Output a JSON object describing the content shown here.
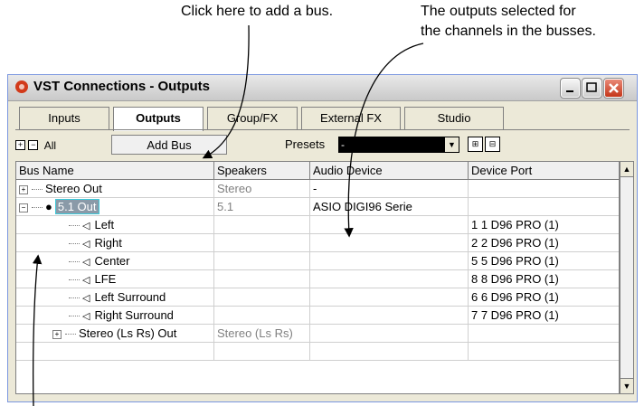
{
  "callouts": {
    "add_bus": "Click here to add a bus.",
    "outputs_line1": "The outputs selected for",
    "outputs_line2": "the channels in the busses."
  },
  "window": {
    "title": "VST Connections - Outputs",
    "controls": [
      "minimize",
      "maximize",
      "close"
    ]
  },
  "tabs": [
    "Inputs",
    "Outputs",
    "Group/FX",
    "External FX",
    "Studio"
  ],
  "active_tab": "Outputs",
  "toolbar": {
    "expand_all_label": "All",
    "add_bus_label": "Add Bus",
    "presets_label": "Presets",
    "presets_value": "-"
  },
  "table": {
    "columns": [
      "Bus Name",
      "Speakers",
      "Audio Device",
      "Device Port"
    ],
    "rows": [
      {
        "name": "Stereo Out",
        "speakers": "Stereo",
        "device": "-",
        "port": ""
      },
      {
        "name": "5.1 Out",
        "speakers": "5.1",
        "device": "ASIO DIGI96 Serie",
        "port": ""
      },
      {
        "name": "Left",
        "speakers": "",
        "device": "",
        "port": "1 1 D96 PRO (1)"
      },
      {
        "name": "Right",
        "speakers": "",
        "device": "",
        "port": "2 2 D96 PRO (1)"
      },
      {
        "name": "Center",
        "speakers": "",
        "device": "",
        "port": "5 5 D96 PRO (1)"
      },
      {
        "name": "LFE",
        "speakers": "",
        "device": "",
        "port": "8 8 D96 PRO (1)"
      },
      {
        "name": "Left Surround",
        "speakers": "",
        "device": "",
        "port": "6 6 D96 PRO (1)"
      },
      {
        "name": "Right Surround",
        "speakers": "",
        "device": "",
        "port": "7 7 D96 PRO (1)"
      },
      {
        "name": "Stereo (Ls Rs) Out",
        "speakers": "Stereo (Ls Rs)",
        "device": "",
        "port": ""
      }
    ]
  }
}
